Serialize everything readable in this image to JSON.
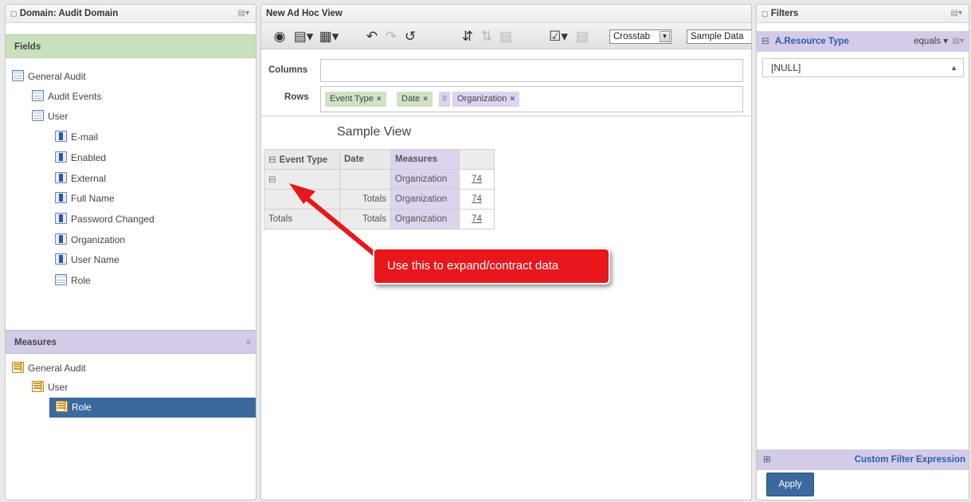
{
  "left_panel": {
    "title": "Domain: Audit Domain",
    "fields_label": "Fields",
    "fields_tree": [
      {
        "label": "General Audit"
      },
      {
        "label": "Audit Events"
      },
      {
        "label": "User"
      },
      {
        "label": "E-mail"
      },
      {
        "label": "Enabled"
      },
      {
        "label": "External"
      },
      {
        "label": "Full Name"
      },
      {
        "label": "Password Changed"
      },
      {
        "label": "Organization"
      },
      {
        "label": "User Name"
      },
      {
        "label": "Role"
      }
    ],
    "measures_label": "Measures",
    "measures_tree": [
      {
        "label": "General Audit"
      },
      {
        "label": "User"
      },
      {
        "label": "Role",
        "selected": true
      }
    ]
  },
  "center_panel": {
    "title": "New Ad Hoc View",
    "toolbar": {
      "view_type": "Crosstab",
      "data_mode": "Sample Data"
    },
    "columns_label": "Columns",
    "rows_label": "Rows",
    "row_chips": [
      {
        "label": "Event Type"
      },
      {
        "label": "Date"
      },
      {
        "label": "#"
      },
      {
        "label": "Organization"
      }
    ],
    "view_title": "Sample View",
    "crosstab": {
      "headers": [
        "Event Type",
        "Date",
        "Measures"
      ],
      "rows": [
        {
          "event_type": "⊟",
          "date": "",
          "measure": "Organization",
          "value": "74"
        },
        {
          "event_type": "",
          "date": "Totals",
          "measure": "Organization",
          "value": "74"
        },
        {
          "event_type": "Totals",
          "date": "Totals",
          "measure": "Organization",
          "value": "74"
        }
      ]
    },
    "callout_text": "Use this to expand/contract data"
  },
  "right_panel": {
    "title": "Filters",
    "filter_name": "A.Resource Type",
    "filter_operator": "equals",
    "filter_value": "[NULL]",
    "custom_filter_label": "Custom Filter Expression",
    "apply_label": "Apply"
  }
}
